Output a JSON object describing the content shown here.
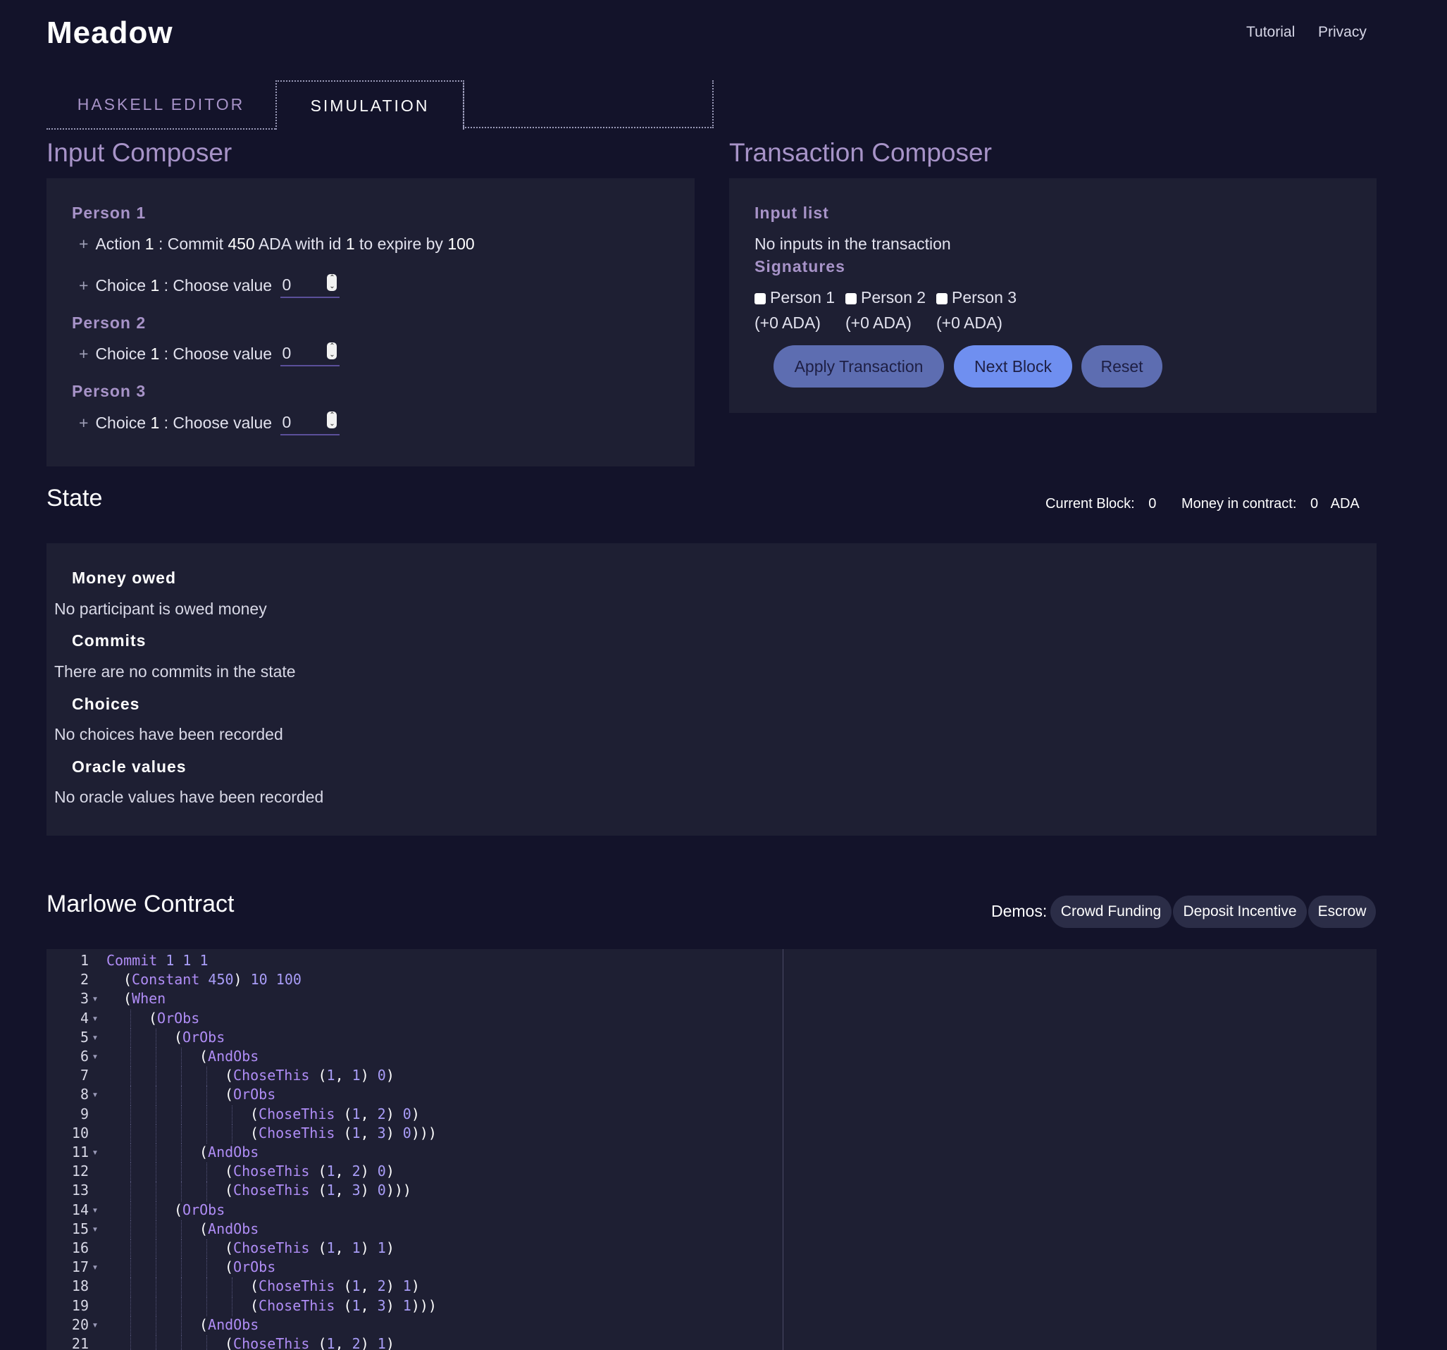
{
  "app": {
    "title": "Meadow"
  },
  "nav": {
    "tutorial": "Tutorial",
    "privacy": "Privacy"
  },
  "tabs": {
    "haskell": "HASKELL EDITOR",
    "simulation": "SIMULATION"
  },
  "input_composer": {
    "title": "Input Composer",
    "persons": [
      {
        "name": "Person 1",
        "action": {
          "word": "Action",
          "id": "1",
          "commit": ": Commit",
          "amount": "450",
          "ada_id": "ADA with id",
          "commit_id": "1",
          "expire": "to expire by",
          "block": "100"
        },
        "choice": {
          "word": "Choice",
          "id": "1",
          "label": ": Choose value",
          "value": "0"
        }
      },
      {
        "name": "Person 2",
        "choice": {
          "word": "Choice",
          "id": "1",
          "label": ": Choose value",
          "value": "0"
        }
      },
      {
        "name": "Person 3",
        "choice": {
          "word": "Choice",
          "id": "1",
          "label": ": Choose value",
          "value": "0"
        }
      }
    ]
  },
  "transaction_composer": {
    "title": "Transaction Composer",
    "input_list_label": "Input list",
    "no_inputs": "No inputs in the transaction",
    "signatures_label": "Signatures",
    "signatures": [
      {
        "name": "Person 1",
        "ada": "(+0 ADA)",
        "checked": false
      },
      {
        "name": "Person 2",
        "ada": "(+0 ADA)",
        "checked": false
      },
      {
        "name": "Person 3",
        "ada": "(+0 ADA)",
        "checked": false
      }
    ],
    "buttons": {
      "apply": "Apply Transaction",
      "next": "Next Block",
      "reset": "Reset"
    }
  },
  "state": {
    "title": "State",
    "current_block_label": "Current Block:",
    "current_block": "0",
    "money_label": "Money in contract:",
    "money": "0",
    "money_unit": "ADA",
    "sections": [
      {
        "heading": "Money owed",
        "text": "No participant is owed money"
      },
      {
        "heading": "Commits",
        "text": "There are no commits in the state"
      },
      {
        "heading": "Choices",
        "text": "No choices have been recorded"
      },
      {
        "heading": "Oracle values",
        "text": "No oracle values have been recorded"
      }
    ]
  },
  "contract": {
    "title": "Marlowe Contract",
    "demos_label": "Demos:",
    "demos": [
      "Crowd Funding",
      "Deposit Incentive",
      "Escrow"
    ],
    "lines": [
      {
        "n": "1",
        "fold": false,
        "indent": 0,
        "text": "Commit 1 1 1"
      },
      {
        "n": "2",
        "fold": false,
        "indent": 1,
        "text": "(Constant 450) 10 100"
      },
      {
        "n": "3",
        "fold": true,
        "indent": 1,
        "text": "(When"
      },
      {
        "n": "4",
        "fold": true,
        "indent": 2,
        "text": "(OrObs"
      },
      {
        "n": "5",
        "fold": true,
        "indent": 3,
        "text": "(OrObs"
      },
      {
        "n": "6",
        "fold": true,
        "indent": 4,
        "text": "(AndObs"
      },
      {
        "n": "7",
        "fold": false,
        "indent": 5,
        "text": "(ChoseThis (1, 1) 0)"
      },
      {
        "n": "8",
        "fold": true,
        "indent": 5,
        "text": "(OrObs"
      },
      {
        "n": "9",
        "fold": false,
        "indent": 6,
        "text": "(ChoseThis (1, 2) 0)"
      },
      {
        "n": "10",
        "fold": false,
        "indent": 6,
        "text": "(ChoseThis (1, 3) 0)))"
      },
      {
        "n": "11",
        "fold": true,
        "indent": 4,
        "text": "(AndObs"
      },
      {
        "n": "12",
        "fold": false,
        "indent": 5,
        "text": "(ChoseThis (1, 2) 0)"
      },
      {
        "n": "13",
        "fold": false,
        "indent": 5,
        "text": "(ChoseThis (1, 3) 0)))"
      },
      {
        "n": "14",
        "fold": true,
        "indent": 3,
        "text": "(OrObs"
      },
      {
        "n": "15",
        "fold": true,
        "indent": 4,
        "text": "(AndObs"
      },
      {
        "n": "16",
        "fold": false,
        "indent": 5,
        "text": "(ChoseThis (1, 1) 1)"
      },
      {
        "n": "17",
        "fold": true,
        "indent": 5,
        "text": "(OrObs"
      },
      {
        "n": "18",
        "fold": false,
        "indent": 6,
        "text": "(ChoseThis (1, 2) 1)"
      },
      {
        "n": "19",
        "fold": false,
        "indent": 6,
        "text": "(ChoseThis (1, 3) 1)))"
      },
      {
        "n": "20",
        "fold": true,
        "indent": 4,
        "text": "(AndObs"
      },
      {
        "n": "21",
        "fold": false,
        "indent": 5,
        "text": "(ChoseThis (1, 2) 1)"
      }
    ]
  },
  "colors": {
    "background": "#13132a",
    "panel": "#1e1f33",
    "accent": "#a793c8",
    "keyword": "#b08df6",
    "button_next": "#6f8ff0",
    "button_other": "#5d6db1"
  }
}
